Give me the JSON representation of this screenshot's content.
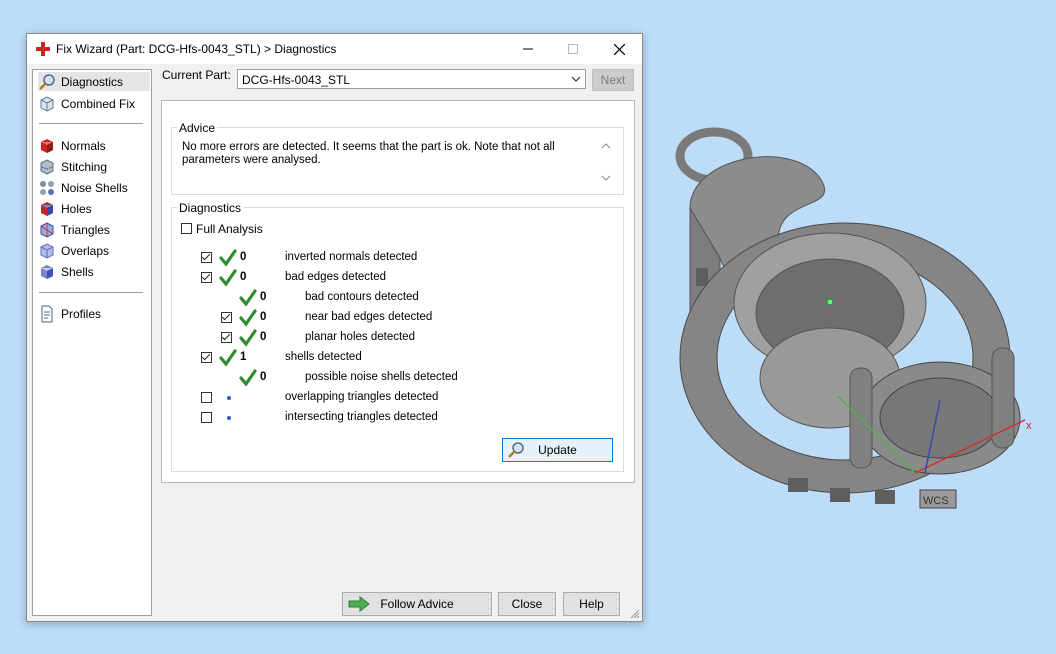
{
  "window": {
    "title": "Fix Wizard (Part: DCG-Hfs-0043_STL) > Diagnostics",
    "icons": {
      "app": "red-cross-icon",
      "minimize": "minimize-icon",
      "maximize": "maximize-icon",
      "close": "close-icon"
    }
  },
  "sidebar": {
    "items": [
      {
        "label": "Diagnostics",
        "icon": "magnifier-icon",
        "selected": true
      },
      {
        "label": "Combined Fix",
        "icon": "combined-fix-icon"
      },
      {
        "label": "Normals",
        "icon": "normals-cube-icon"
      },
      {
        "label": "Stitching",
        "icon": "stitching-cube-icon"
      },
      {
        "label": "Noise Shells",
        "icon": "noise-shells-icon"
      },
      {
        "label": "Holes",
        "icon": "holes-cube-icon"
      },
      {
        "label": "Triangles",
        "icon": "triangles-cube-icon"
      },
      {
        "label": "Overlaps",
        "icon": "overlaps-cube-icon"
      },
      {
        "label": "Shells",
        "icon": "shells-cube-icon"
      },
      {
        "label": "Profiles",
        "icon": "document-icon"
      }
    ]
  },
  "current_part": {
    "label": "Current Part:",
    "value": "DCG-Hfs-0043_STL",
    "next_label": "Next"
  },
  "advice": {
    "title": "Advice",
    "text": "No more errors are detected. It seems that the part is ok. Note that not all parameters were analysed."
  },
  "diagnostics": {
    "title": "Diagnostics",
    "full_analysis_label": "Full Analysis",
    "rows": [
      {
        "checked": true,
        "status": "check",
        "count": "0",
        "label": "inverted normals detected"
      },
      {
        "checked": true,
        "status": "check",
        "count": "0",
        "label": "bad edges detected"
      },
      {
        "status": "check",
        "count": "0",
        "label": "bad contours detected"
      },
      {
        "checked": true,
        "status": "check",
        "count": "0",
        "label": "near bad edges detected"
      },
      {
        "checked": true,
        "status": "check",
        "count": "0",
        "label": "planar holes detected"
      },
      {
        "checked": true,
        "status": "check",
        "count": "1",
        "label": "shells detected"
      },
      {
        "status": "check",
        "count": "0",
        "label": "possible noise shells detected"
      },
      {
        "checked": false,
        "status": "dot",
        "count": "",
        "label": "overlapping triangles detected"
      },
      {
        "checked": false,
        "status": "dot",
        "count": "",
        "label": "intersecting triangles detected"
      }
    ],
    "update_label": "Update"
  },
  "footer": {
    "follow_advice_label": "Follow Advice",
    "close_label": "Close",
    "help_label": "Help"
  },
  "viewport": {
    "axis_x_label": "x",
    "wcs_label": "WCS"
  }
}
